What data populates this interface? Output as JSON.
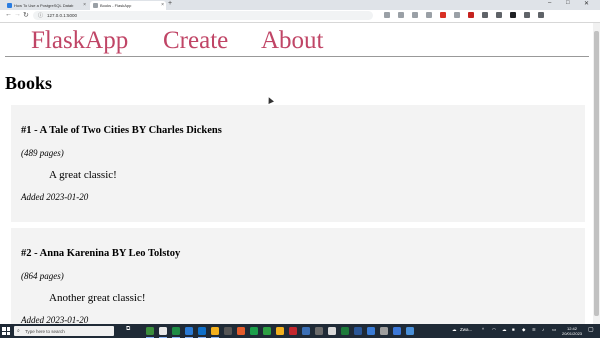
{
  "browser": {
    "tabs": [
      {
        "label": "How To Use a PostgreSQL Datab",
        "active": false,
        "favicon_color": "#2a7de1"
      },
      {
        "label": "Books - FlaskApp",
        "active": true,
        "favicon_color": "#9aa0a6"
      }
    ],
    "address": "127.0.0.1:5000",
    "nav_icons": [
      "back-icon",
      "forward-icon",
      "reload-icon"
    ],
    "extension_colors": [
      "#9aa0a6",
      "#9aa0a6",
      "#9aa0a6",
      "#9aa0a6",
      "#d93025",
      "#9aa0a6",
      "#c5221f",
      "#5f6368",
      "#5f6368",
      "#202124",
      "#5f6368",
      "#5f6368"
    ]
  },
  "site": {
    "brand": "FlaskApp",
    "nav": [
      "Create",
      "About"
    ],
    "accent_color": "#c04566"
  },
  "page": {
    "title": "Books",
    "books": [
      {
        "heading": "#1 - A Tale of Two Cities BY Charles Dickens",
        "pages": "(489 pages)",
        "review": "A great classic!",
        "added": "Added 2023-01-20"
      },
      {
        "heading": "#2 - Anna Karenina BY Leo Tolstoy",
        "pages": "(864 pages)",
        "review": "Another great classic!",
        "added": "Added 2023-01-20"
      }
    ]
  },
  "taskbar": {
    "search_placeholder": "Type here to search",
    "app_icon_colors": [
      "#3c8f3c",
      "#e8e8e8",
      "#1e8c45",
      "#2b7bd6",
      "#0e6fc9",
      "#f2b01e",
      "#555555",
      "#e35b2b",
      "#1b9e4a",
      "#2ea043",
      "#f2b01e",
      "#c2272d",
      "#3b6fb6",
      "#6b6b6b",
      "#d9d9d9",
      "#1d7a3a",
      "#2b5797",
      "#3a7bd5",
      "#9e9e9e",
      "#3c78d8",
      "#4a90d9"
    ],
    "weather": "Zwa...",
    "time": "12:42",
    "date": "20/01/2023"
  }
}
